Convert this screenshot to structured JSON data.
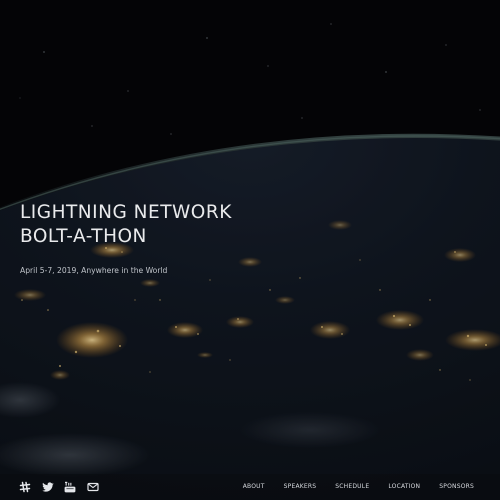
{
  "hero": {
    "title_line1": "LIGHTNING NETWORK",
    "title_line2": "BOLT-A-THON",
    "subtitle": "April 5-7, 2019, Anywhere in the World"
  },
  "social": [
    {
      "icon": "slack-icon"
    },
    {
      "icon": "twitter-icon"
    },
    {
      "icon": "youtube-icon"
    },
    {
      "icon": "mail-icon"
    }
  ],
  "nav": {
    "items": [
      "ABOUT",
      "SPEAKERS",
      "SCHEDULE",
      "LOCATION",
      "SPONSORS"
    ]
  },
  "colors": {
    "background": "#050608",
    "title": "#e9eaec",
    "city_lights": "#f2c66d",
    "atmosphere": "#3c5a6e"
  }
}
